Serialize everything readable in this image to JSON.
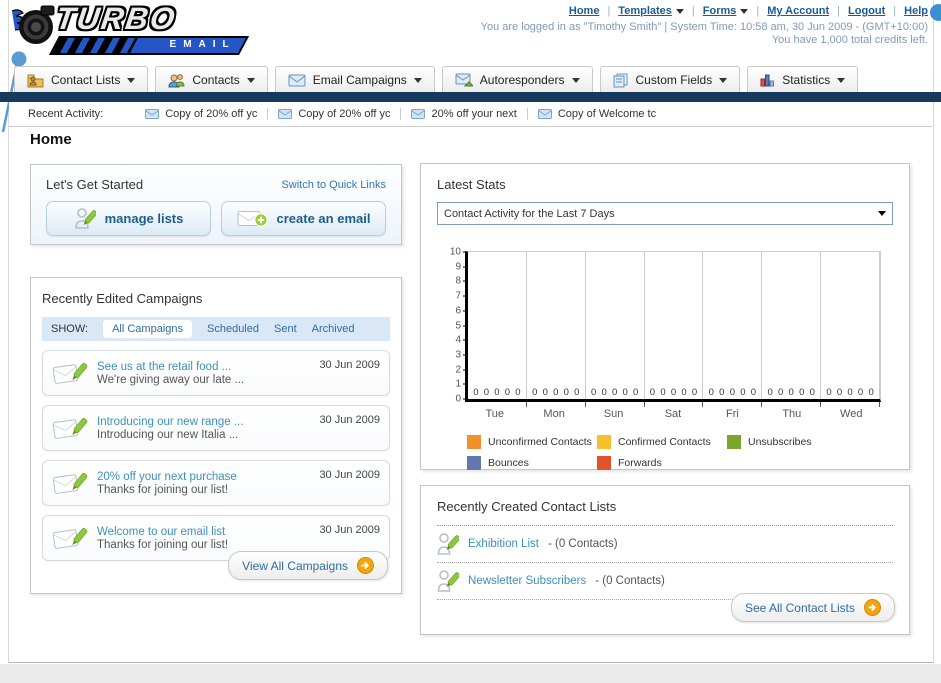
{
  "header": {
    "logo_title": "TURBO",
    "logo_subtitle": "EMAIL",
    "nav": [
      {
        "label": "Home"
      },
      {
        "label": "Templates"
      },
      {
        "label": "Forms"
      },
      {
        "label": "My Account"
      },
      {
        "label": "Logout"
      },
      {
        "label": "Help"
      }
    ],
    "login_info": "You are logged in as \"Timothy Smith\" | System Time: 10:58 am, 30 Jun 2009 - (GMT+10:00)",
    "credits_info": "You have 1,000 total credits left."
  },
  "menu_tabs": [
    {
      "label": "Contact Lists",
      "icon": "contact-lists-icon"
    },
    {
      "label": "Contacts",
      "icon": "contacts-icon"
    },
    {
      "label": "Email Campaigns",
      "icon": "email-campaigns-icon"
    },
    {
      "label": "Autoresponders",
      "icon": "autoresponders-icon"
    },
    {
      "label": "Custom Fields",
      "icon": "custom-fields-icon"
    },
    {
      "label": "Statistics",
      "icon": "statistics-icon"
    }
  ],
  "recent_activity": {
    "label": "Recent Activity:",
    "items": [
      {
        "text": "Copy of 20% off yc"
      },
      {
        "text": "Copy of 20% off yc"
      },
      {
        "text": "20% off your next"
      },
      {
        "text": "Copy of Welcome tc"
      }
    ]
  },
  "page_title": "Home",
  "get_started": {
    "title": "Let's Get Started",
    "switch_link": "Switch to Quick Links",
    "buttons": [
      {
        "label": "manage lists"
      },
      {
        "label": "create an email"
      }
    ]
  },
  "campaigns_panel": {
    "title": "Recently Edited Campaigns",
    "show_label": "SHOW:",
    "tabs": [
      "All Campaigns",
      "Scheduled",
      "Sent",
      "Archived"
    ],
    "active_tab": "All Campaigns",
    "items": [
      {
        "title": "See us at the retail food ...",
        "subtitle": "We're giving away our late ...",
        "date": "30 Jun 2009"
      },
      {
        "title": "Introducing our new range ...",
        "subtitle": "Introducing our new Italia ...",
        "date": "30 Jun 2009"
      },
      {
        "title": "20% off your next purchase",
        "subtitle": "Thanks for joining our list!",
        "date": "30 Jun 2009"
      },
      {
        "title": "Welcome to our email list",
        "subtitle": "Thanks for joining our list!",
        "date": "30 Jun 2009"
      }
    ],
    "view_all_label": "View All Campaigns"
  },
  "stats_panel": {
    "title": "Latest Stats",
    "filter_value": "Contact Activity for the Last 7 Days"
  },
  "chart_data": {
    "type": "bar",
    "title": "Contact Activity for the Last 7 Days",
    "categories": [
      "Tue",
      "Mon",
      "Sun",
      "Sat",
      "Fri",
      "Thu",
      "Wed"
    ],
    "series": [
      {
        "name": "Unconfirmed Contacts",
        "color": "#F0922B",
        "values": [
          0,
          0,
          0,
          0,
          0,
          0,
          0
        ]
      },
      {
        "name": "Confirmed Contacts",
        "color": "#F5C02C",
        "values": [
          0,
          0,
          0,
          0,
          0,
          0,
          0
        ]
      },
      {
        "name": "Unsubscribes",
        "color": "#7BA62B",
        "values": [
          0,
          0,
          0,
          0,
          0,
          0,
          0
        ]
      },
      {
        "name": "Bounces",
        "color": "#6379AE",
        "values": [
          0,
          0,
          0,
          0,
          0,
          0,
          0
        ]
      },
      {
        "name": "Forwards",
        "color": "#E2532B",
        "values": [
          0,
          0,
          0,
          0,
          0,
          0,
          0
        ]
      }
    ],
    "xlabel": "",
    "ylabel": "",
    "ylim": [
      0,
      10
    ],
    "yticks": [
      0,
      1,
      2,
      3,
      4,
      5,
      6,
      7,
      8,
      9,
      10
    ],
    "grid": true,
    "legend_position": "bottom",
    "data_labels": "0 shown above baseline for every bar"
  },
  "contact_lists_panel": {
    "title": "Recently Created Contact Lists",
    "items": [
      {
        "name": "Exhibition List",
        "detail": "- (0 Contacts)"
      },
      {
        "name": "Newsletter Subscribers",
        "detail": "- (0 Contacts)"
      }
    ],
    "see_all_label": "See All Contact Lists"
  },
  "colors": {
    "navy_bar": "#16395E",
    "accent_orange": "#F2A50C",
    "link_blue": "#2E6DA4",
    "campaign_link_blue": "#3D8FBF",
    "logo_blue": "#2457C5"
  }
}
